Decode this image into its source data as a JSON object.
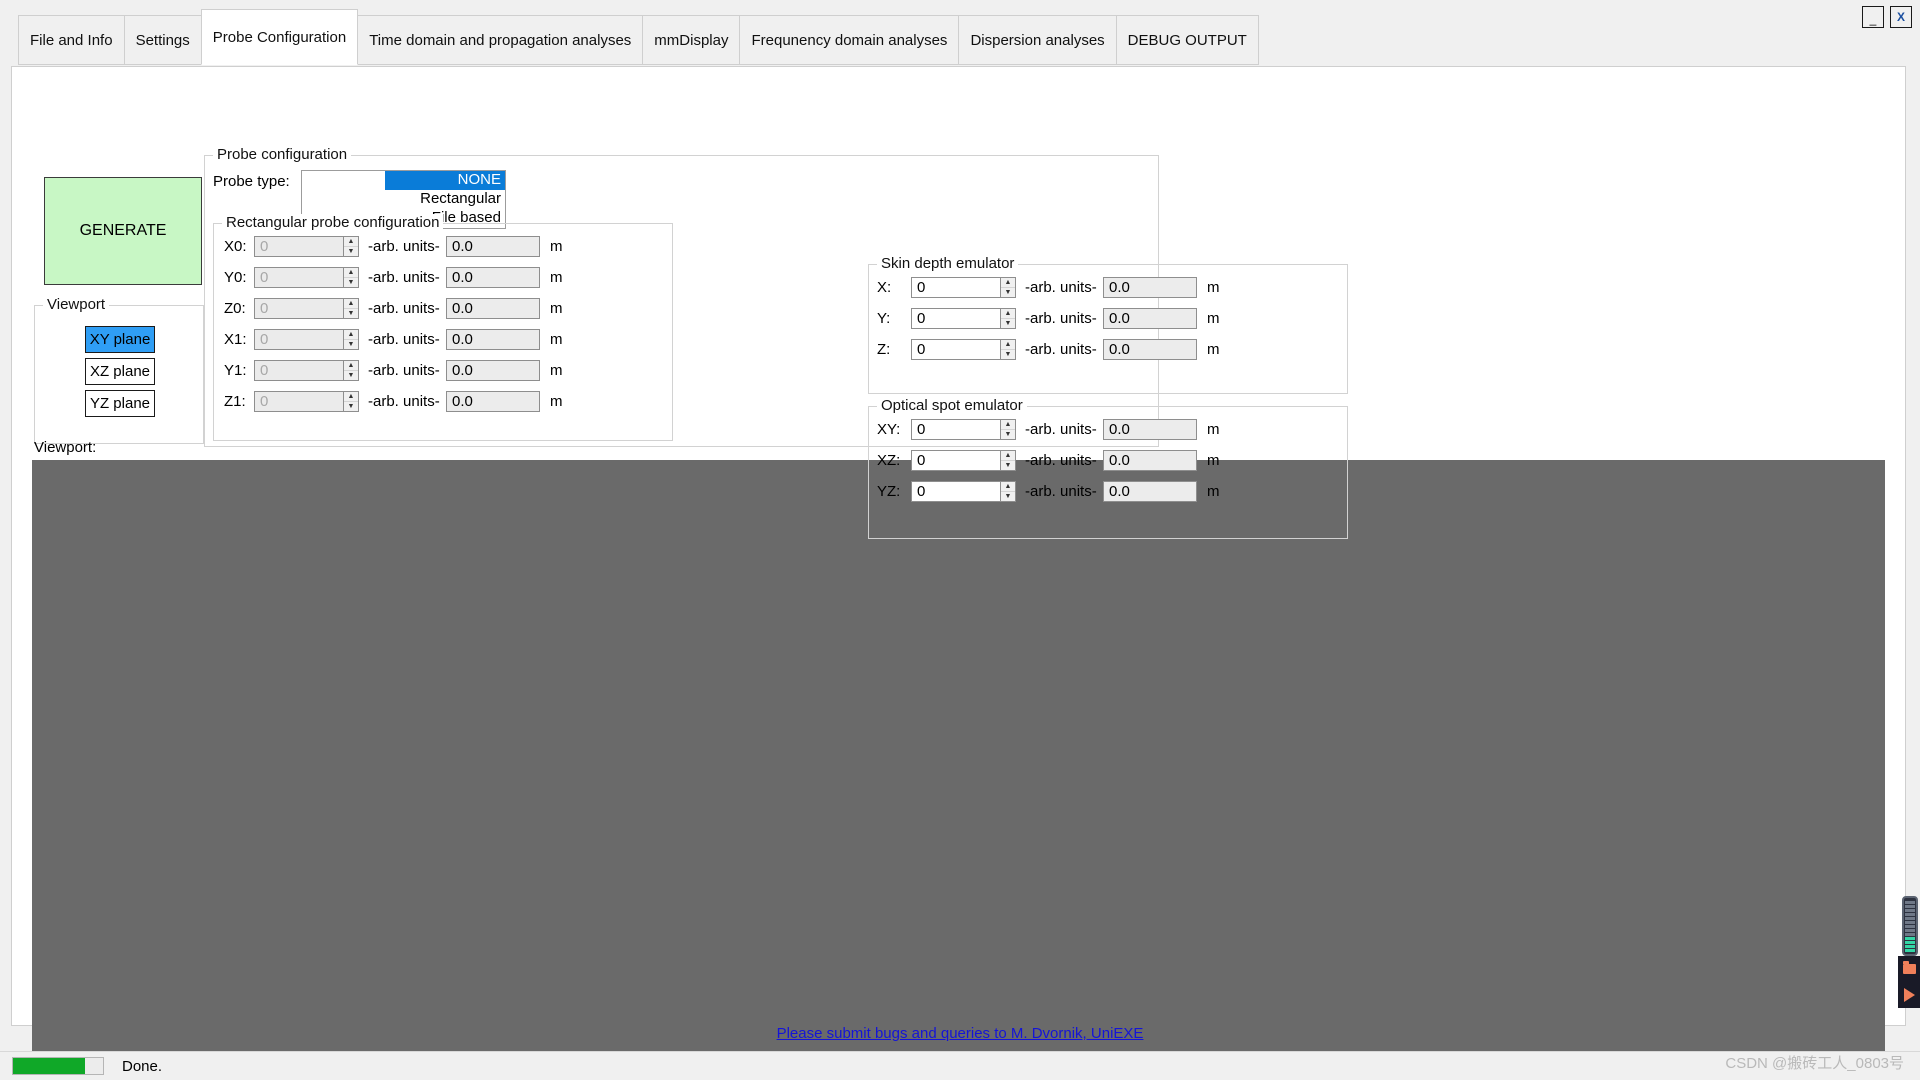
{
  "window": {
    "minimize_label": "_",
    "close_label": "X"
  },
  "tabs": [
    {
      "label": "File and Info",
      "active": false
    },
    {
      "label": "Settings",
      "active": false
    },
    {
      "label": "Probe Configuration",
      "active": true
    },
    {
      "label": "Time domain and propagation analyses",
      "active": false
    },
    {
      "label": "mmDisplay",
      "active": false
    },
    {
      "label": "Frequnency domain analyses",
      "active": false
    },
    {
      "label": "Dispersion analyses",
      "active": false
    },
    {
      "label": "DEBUG OUTPUT",
      "active": false
    }
  ],
  "generate": {
    "label": "GENERATE",
    "color": "#c8f7c5"
  },
  "viewport_group": {
    "legend": "Viewport",
    "buttons": [
      {
        "label": "XY plane",
        "selected": true
      },
      {
        "label": "XZ plane",
        "selected": false
      },
      {
        "label": "YZ plane",
        "selected": false
      }
    ],
    "selected_color": "#2f9ef5"
  },
  "viewport_label": "Viewport:",
  "canvas": {
    "color": "#6a6a6a"
  },
  "probe_configuration": {
    "legend": "Probe configuration",
    "probe_type_label": "Probe type:",
    "probe_type_options": [
      {
        "label": "NONE",
        "selected": true
      },
      {
        "label": "Rectangular",
        "selected": false
      },
      {
        "label": "File based",
        "selected": false
      }
    ],
    "selected_color": "#0a7cd8"
  },
  "rectangular_probe": {
    "legend": "Rectangular probe configuration",
    "units_label": "-arb. units-",
    "meter_label": "m",
    "enabled": false,
    "rows": [
      {
        "label": "X0:",
        "spin_value": "0",
        "text_value": "0.0"
      },
      {
        "label": "Y0:",
        "spin_value": "0",
        "text_value": "0.0"
      },
      {
        "label": "Z0:",
        "spin_value": "0",
        "text_value": "0.0"
      },
      {
        "label": "X1:",
        "spin_value": "0",
        "text_value": "0.0"
      },
      {
        "label": "Y1:",
        "spin_value": "0",
        "text_value": "0.0"
      },
      {
        "label": "Z1:",
        "spin_value": "0",
        "text_value": "0.0"
      }
    ]
  },
  "skin_depth": {
    "legend": "Skin depth emulator",
    "units_label": "-arb. units-",
    "meter_label": "m",
    "enabled": true,
    "rows": [
      {
        "label": "X:",
        "spin_value": "0",
        "text_value": "0.0"
      },
      {
        "label": "Y:",
        "spin_value": "0",
        "text_value": "0.0"
      },
      {
        "label": "Z:",
        "spin_value": "0",
        "text_value": "0.0"
      }
    ]
  },
  "optical_spot": {
    "legend": "Optical spot emulator",
    "units_label": "-arb. units-",
    "meter_label": "m",
    "enabled": true,
    "rows": [
      {
        "label": "XY:",
        "spin_value": "0",
        "text_value": "0.0"
      },
      {
        "label": "XZ:",
        "spin_value": "0",
        "text_value": "0.0"
      },
      {
        "label": "YZ:",
        "spin_value": "0",
        "text_value": "0.0"
      }
    ]
  },
  "footer": {
    "link_text": "Please submit bugs and queries to M. Dvornik, UniEXE",
    "link_color": "#1414d8"
  },
  "statusbar": {
    "progress_percent": 80,
    "progress_color": "#10a828",
    "status_text": "Done."
  },
  "watermark": "CSDN @搬砖工人_0803号",
  "edge_widgets": {
    "level_filled": 4,
    "level_total": 13,
    "folder_icon": "folder-icon",
    "play_icon": "play-icon"
  },
  "spinner": {
    "up": "▲",
    "down": "▼"
  }
}
